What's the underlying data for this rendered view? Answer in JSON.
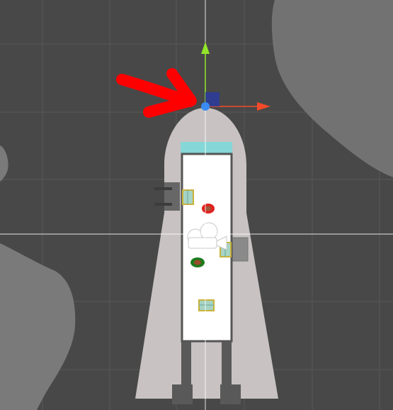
{
  "window": {
    "title": ""
  },
  "scene": {
    "background_color": "#484848",
    "grid_color": "#575757",
    "blob_color": "#7a7a7a",
    "rocket_body_color": "#c8c2c2",
    "rocket_panel_color": "#ffffff",
    "window_cap_color": "#86d7d7",
    "leg_color": "#595959",
    "annotation_arrow_color": "#ff0000"
  },
  "gizmo": {
    "tool": "move-tool",
    "x_axis_color": "#f24a2a",
    "y_axis_color": "#93e52a",
    "plane_handle_color": "#2b3b9c",
    "pivot_color": "#3a8bf2"
  },
  "icons": {
    "camera": "camera-icon",
    "items": [
      "crate-icon",
      "red-gem-icon",
      "crate-icon",
      "green-gem-icon",
      "crate-icon"
    ]
  }
}
